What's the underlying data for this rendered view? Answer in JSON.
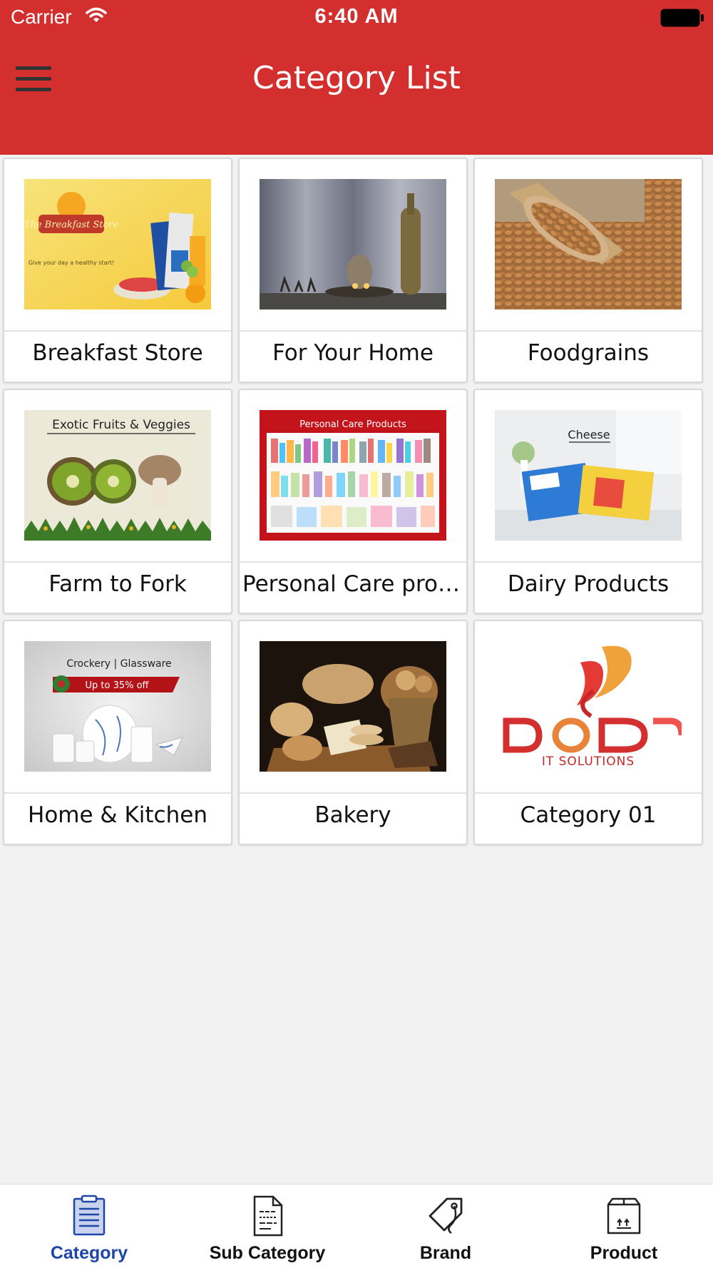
{
  "status_bar": {
    "carrier": "Carrier",
    "time": "6:40 AM"
  },
  "header": {
    "title": "Category List",
    "menu_icon": "hamburger-menu-icon"
  },
  "categories": [
    {
      "label": "Breakfast Store",
      "image": "breakfast-store-banner",
      "image_text": "The Breakfast Store",
      "image_subtext": "Give your day a healthy start!"
    },
    {
      "label": "For Your Home",
      "image": "home-decor-photo"
    },
    {
      "label": "Foodgrains",
      "image": "wheat-grains-scoop-photo"
    },
    {
      "label": "Farm to Fork",
      "image": "exotic-fruits-veggies-banner",
      "image_text": "Exotic Fruits & Veggies"
    },
    {
      "label": "Personal Care prod...",
      "image": "personal-care-products-banner",
      "image_text": "Personal Care Products"
    },
    {
      "label": "Dairy Products",
      "image": "cheese-slices-banner",
      "image_text": "Cheese"
    },
    {
      "label": "Home & Kitchen",
      "image": "crockery-glassware-banner",
      "image_text": "Crockery | Glassware",
      "image_subtext": "Up to 35% off"
    },
    {
      "label": "Bakery",
      "image": "bakery-bread-photo"
    },
    {
      "label": "Category 01",
      "image": "dod-it-solutions-logo",
      "image_text": "IT SOLUTIONS"
    }
  ],
  "tabs": [
    {
      "label": "Category",
      "icon": "clipboard-list-icon",
      "active": true
    },
    {
      "label": "Sub Category",
      "icon": "document-icon",
      "active": false
    },
    {
      "label": "Brand",
      "icon": "price-tag-icon",
      "active": false
    },
    {
      "label": "Product",
      "icon": "package-box-icon",
      "active": false
    }
  ],
  "colors": {
    "header": "#d32f2f",
    "active_tab": "#1e45a8",
    "background": "#f2f2f2"
  }
}
